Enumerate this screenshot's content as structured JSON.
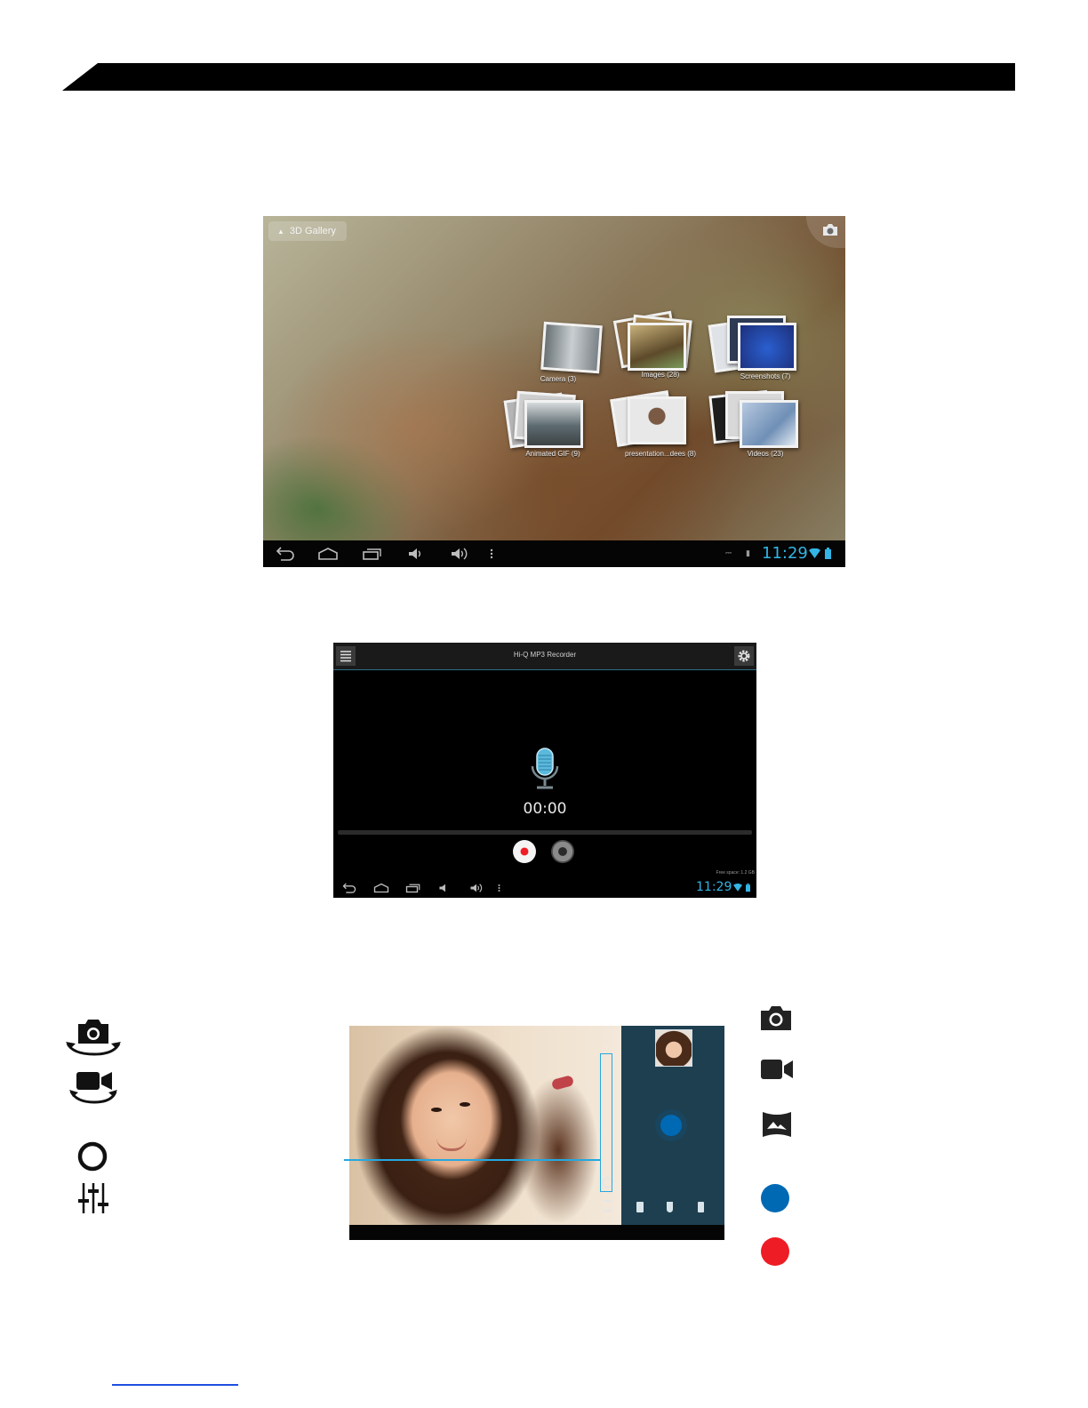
{
  "gallery": {
    "title": "3D Gallery",
    "albums": [
      {
        "label": "Camera (3)"
      },
      {
        "label": "Images (28)"
      },
      {
        "label": "Screenshots (7)"
      },
      {
        "label": "Animated GIF (9)"
      },
      {
        "label": "presentation...dees (8)"
      },
      {
        "label": "Videos (23)"
      }
    ],
    "clock": "11:29"
  },
  "recorder": {
    "title": "Hi-Q MP3 Recorder",
    "timer": "00:00",
    "free_space": "Free space: 1.2 GB",
    "clock": "11:29"
  },
  "colors": {
    "accent_blue": "#25a8e0",
    "shutter_blue": "#0069b4",
    "record_red": "#ee1c24",
    "clock_blue": "#33b5e5"
  },
  "legend": {
    "left": [
      "camera-switch-icon",
      "video-switch-icon",
      "circle-ring-icon",
      "sliders-icon"
    ],
    "right": [
      "camera-icon",
      "video-camera-icon",
      "panorama-icon",
      "blue-dot-icon",
      "red-dot-icon"
    ]
  }
}
